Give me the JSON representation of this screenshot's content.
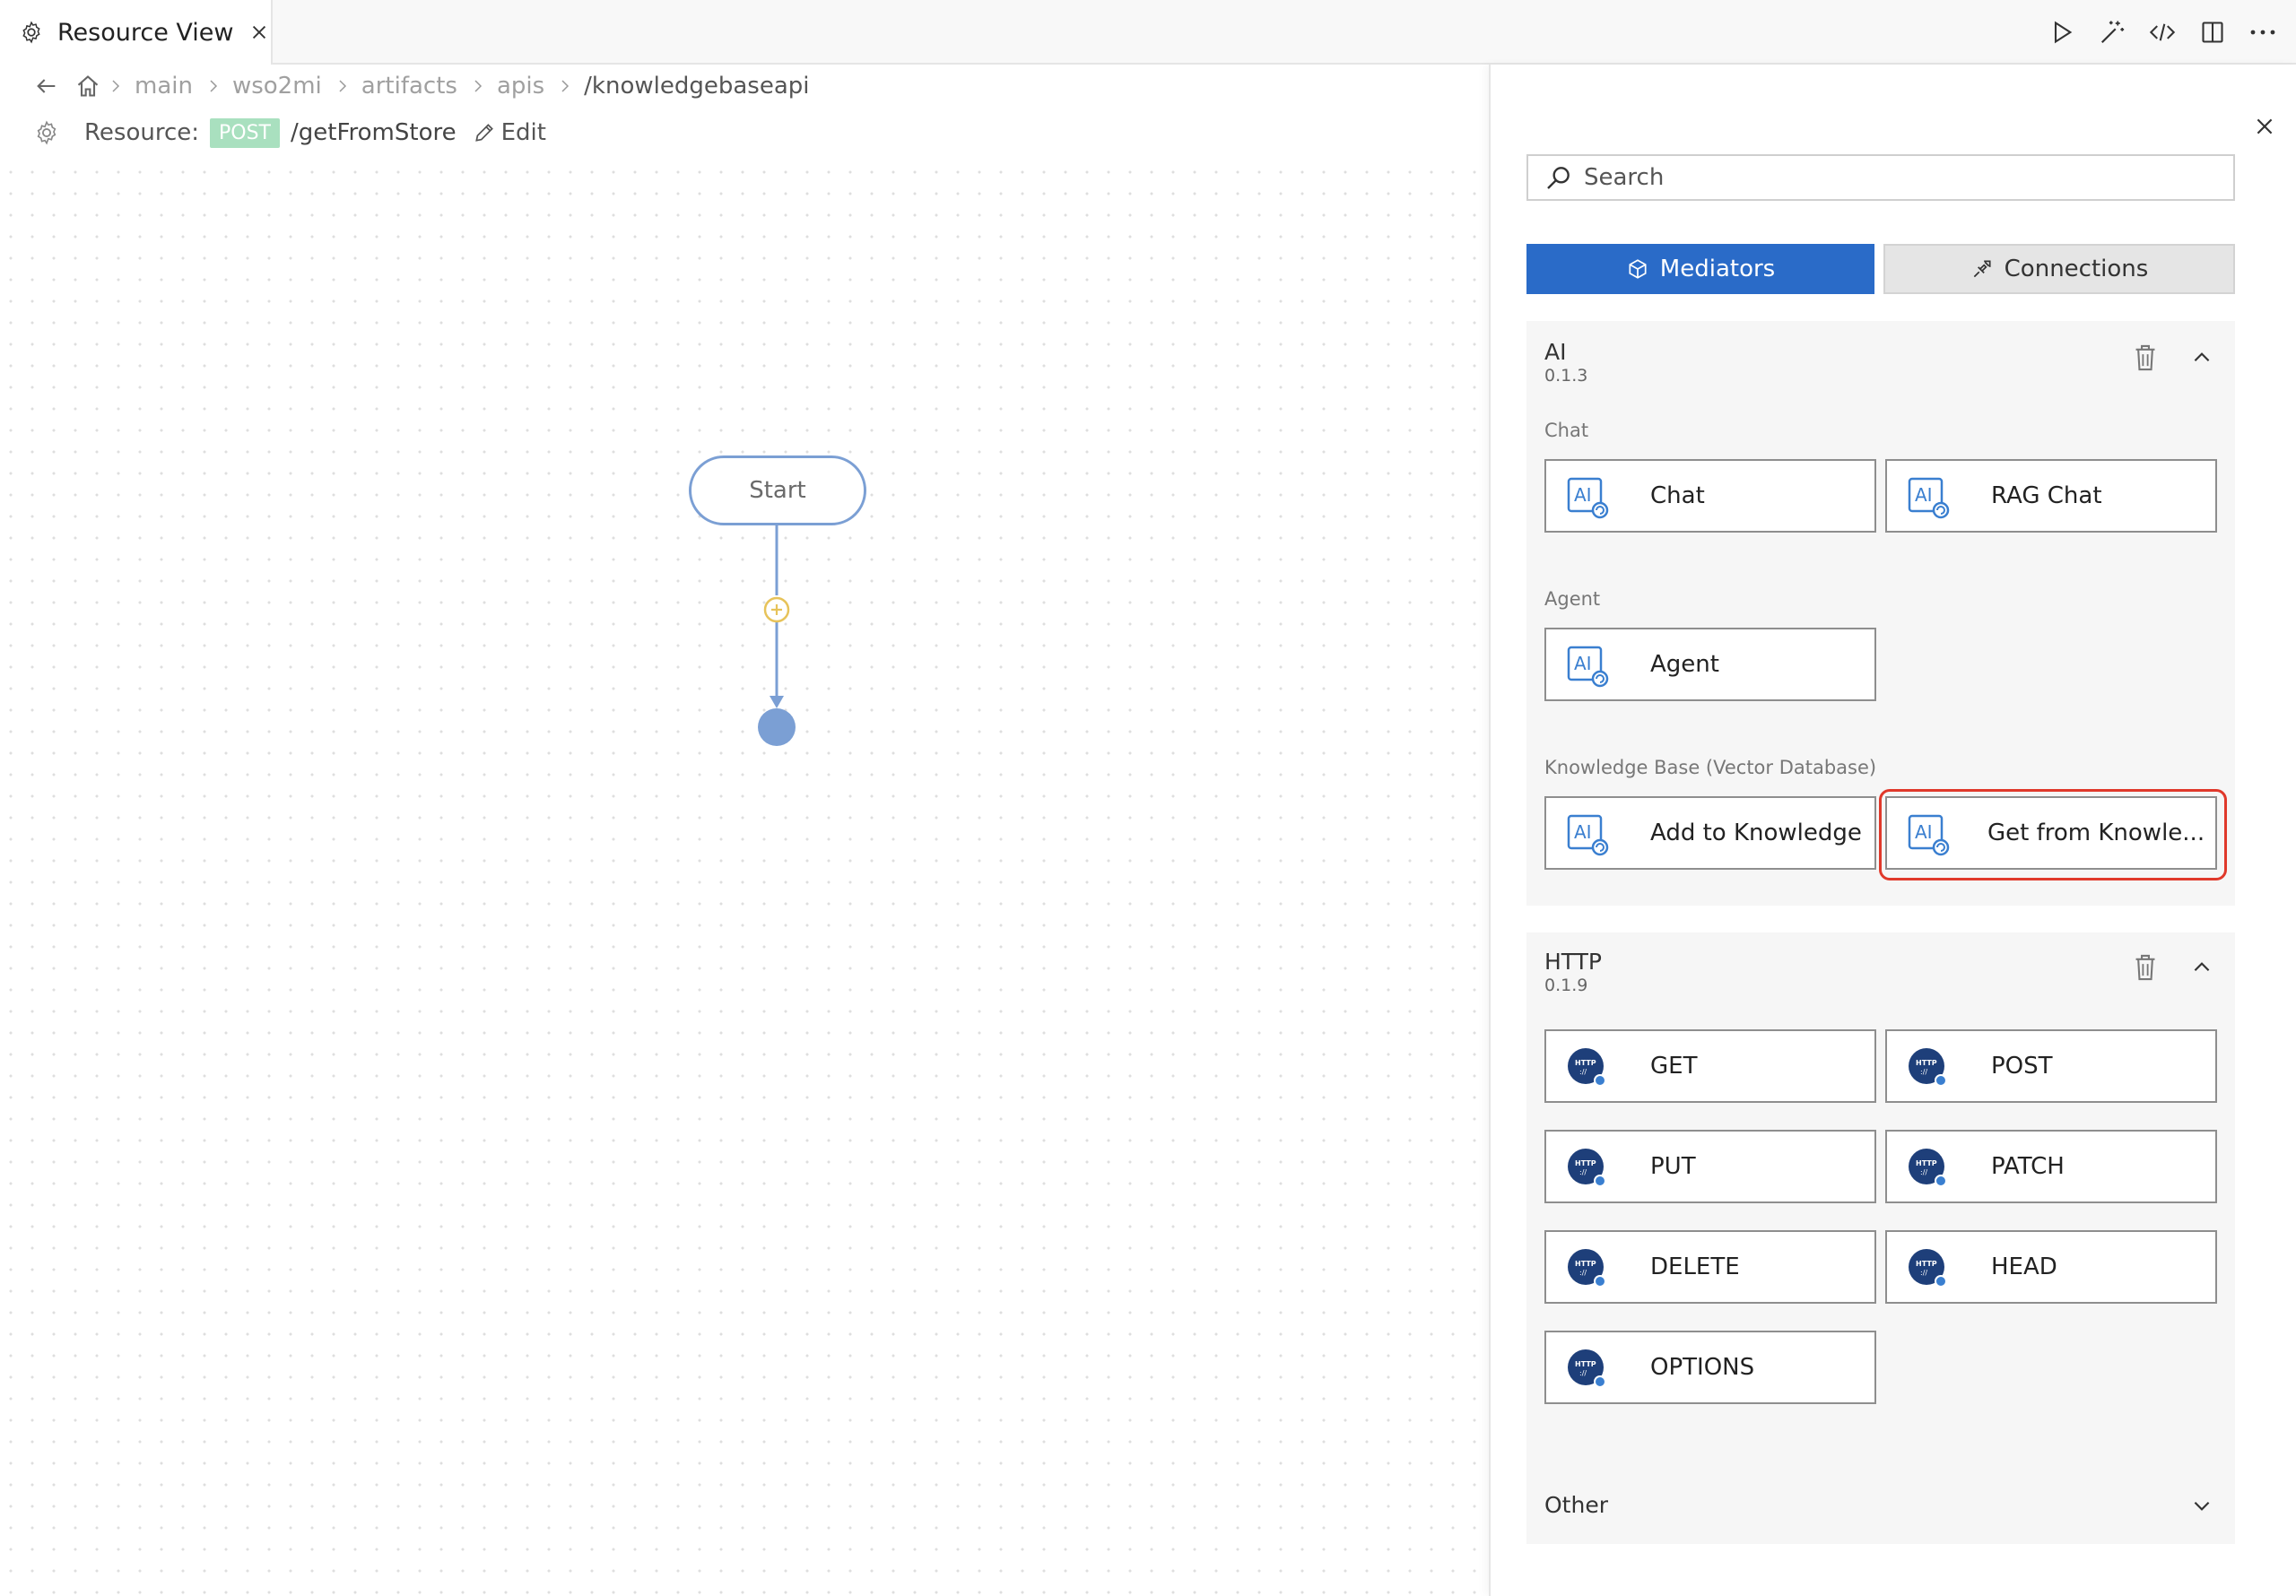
{
  "tab": {
    "title": "Resource View"
  },
  "toolbar": {
    "icons": [
      "run-icon",
      "magic-wand-icon",
      "code-icon",
      "split-editor-icon",
      "more-icon"
    ]
  },
  "breadcrumb": {
    "items": [
      "main",
      "wso2mi",
      "artifacts",
      "apis",
      "/knowledgebaseapi"
    ]
  },
  "resource": {
    "label": "Resource:",
    "method": "POST",
    "path": "/getFromStore",
    "edit_label": "Edit"
  },
  "canvas": {
    "start_label": "Start"
  },
  "panel": {
    "search_placeholder": "Search",
    "tabs": {
      "mediators": "Mediators",
      "connections": "Connections"
    },
    "sections": {
      "ai": {
        "name": "AI",
        "version": "0.1.3",
        "groups": {
          "chat": {
            "label": "Chat",
            "items": [
              "Chat",
              "RAG Chat"
            ]
          },
          "agent": {
            "label": "Agent",
            "items": [
              "Agent"
            ]
          },
          "kb": {
            "label": "Knowledge Base (Vector Database)",
            "items": [
              "Add to Knowledge",
              "Get from Knowle..."
            ]
          }
        }
      },
      "http": {
        "name": "HTTP",
        "version": "0.1.9",
        "items": [
          "GET",
          "POST",
          "PUT",
          "PATCH",
          "DELETE",
          "HEAD",
          "OPTIONS"
        ]
      },
      "other": {
        "name": "Other"
      }
    }
  },
  "colors": {
    "accent": "#2a6bc8",
    "method_badge": "#a9e0bf",
    "highlight": "#e0392b",
    "flow_line": "#7b9fd4",
    "plus_node": "#e7c35a"
  }
}
